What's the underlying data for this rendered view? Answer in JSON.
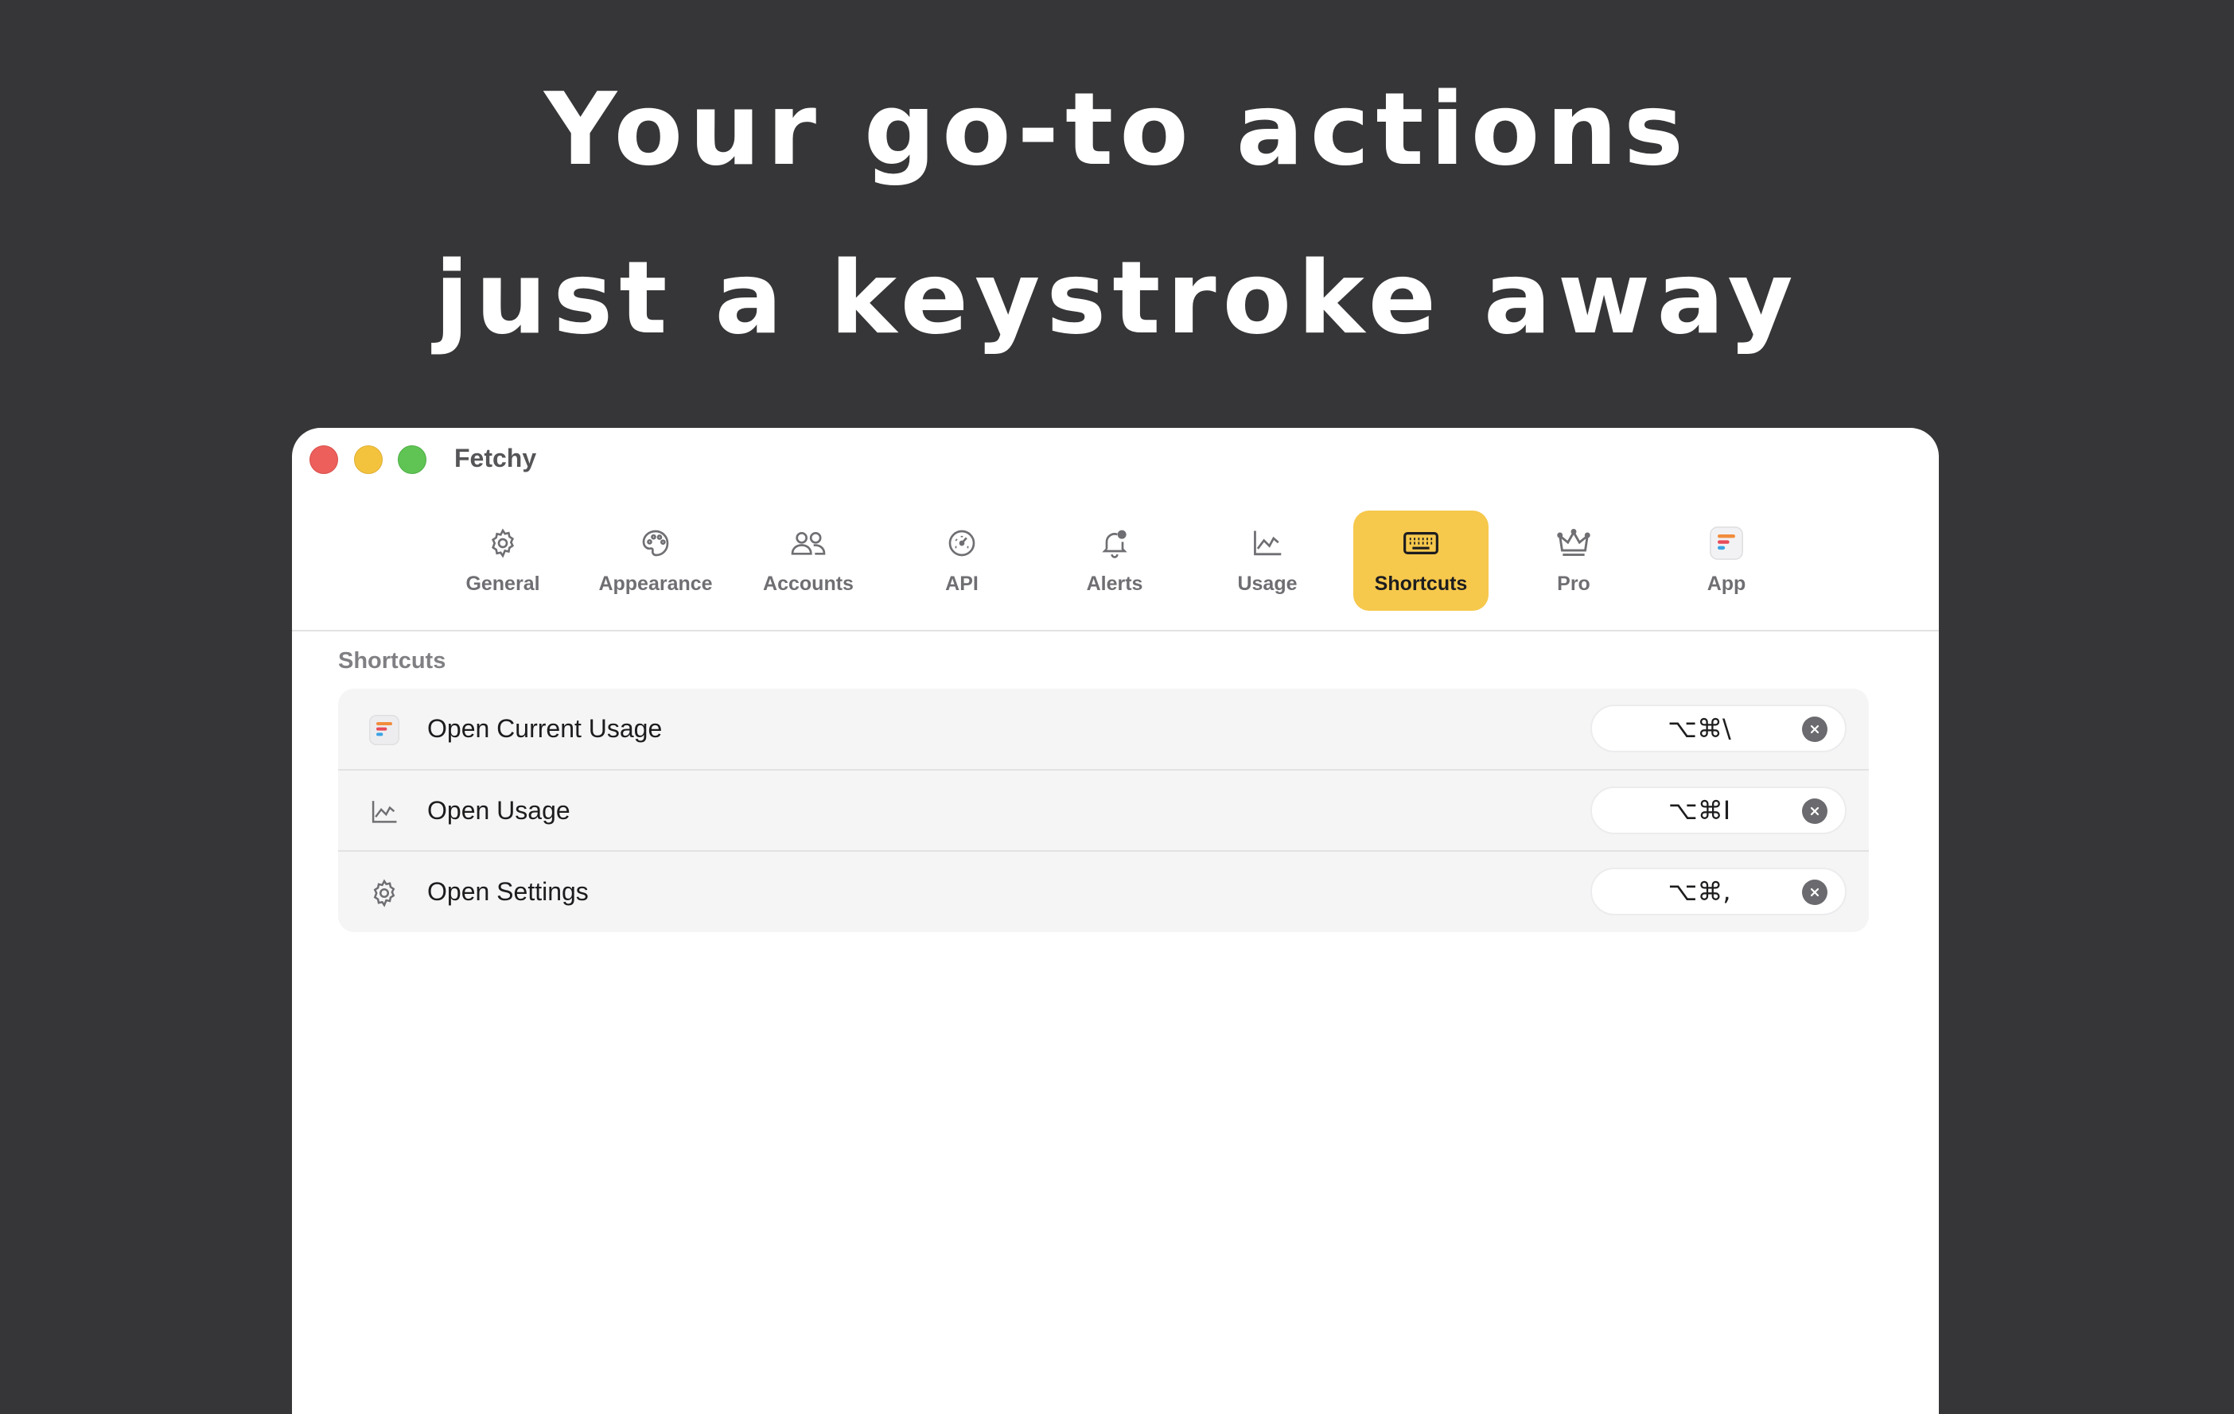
{
  "hero": {
    "line1": "Your go-to actions",
    "line2": "just a keystroke away"
  },
  "window": {
    "title": "Fetchy"
  },
  "tabs": [
    {
      "label": "General",
      "icon": "gear-icon"
    },
    {
      "label": "Appearance",
      "icon": "palette-icon"
    },
    {
      "label": "Accounts",
      "icon": "people-icon"
    },
    {
      "label": "API",
      "icon": "gauge-icon"
    },
    {
      "label": "Alerts",
      "icon": "bell-icon"
    },
    {
      "label": "Usage",
      "icon": "line-chart-icon"
    },
    {
      "label": "Shortcuts",
      "icon": "keyboard-icon",
      "active": true
    },
    {
      "label": "Pro",
      "icon": "crown-icon"
    },
    {
      "label": "App",
      "icon": "app-logo-icon"
    }
  ],
  "section": {
    "title": "Shortcuts"
  },
  "shortcuts": [
    {
      "label": "Open Current Usage",
      "icon": "app-logo-icon",
      "keys": "⌥⌘\\"
    },
    {
      "label": "Open Usage",
      "icon": "line-chart-icon",
      "keys": "⌥⌘I"
    },
    {
      "label": "Open Settings",
      "icon": "gear-icon",
      "keys": "⌥⌘,"
    }
  ],
  "colors": {
    "background": "#363638",
    "accent": "#f6c84c",
    "close": "#ec5f5b",
    "minimize": "#f4c33e",
    "maximize": "#5fc454"
  }
}
